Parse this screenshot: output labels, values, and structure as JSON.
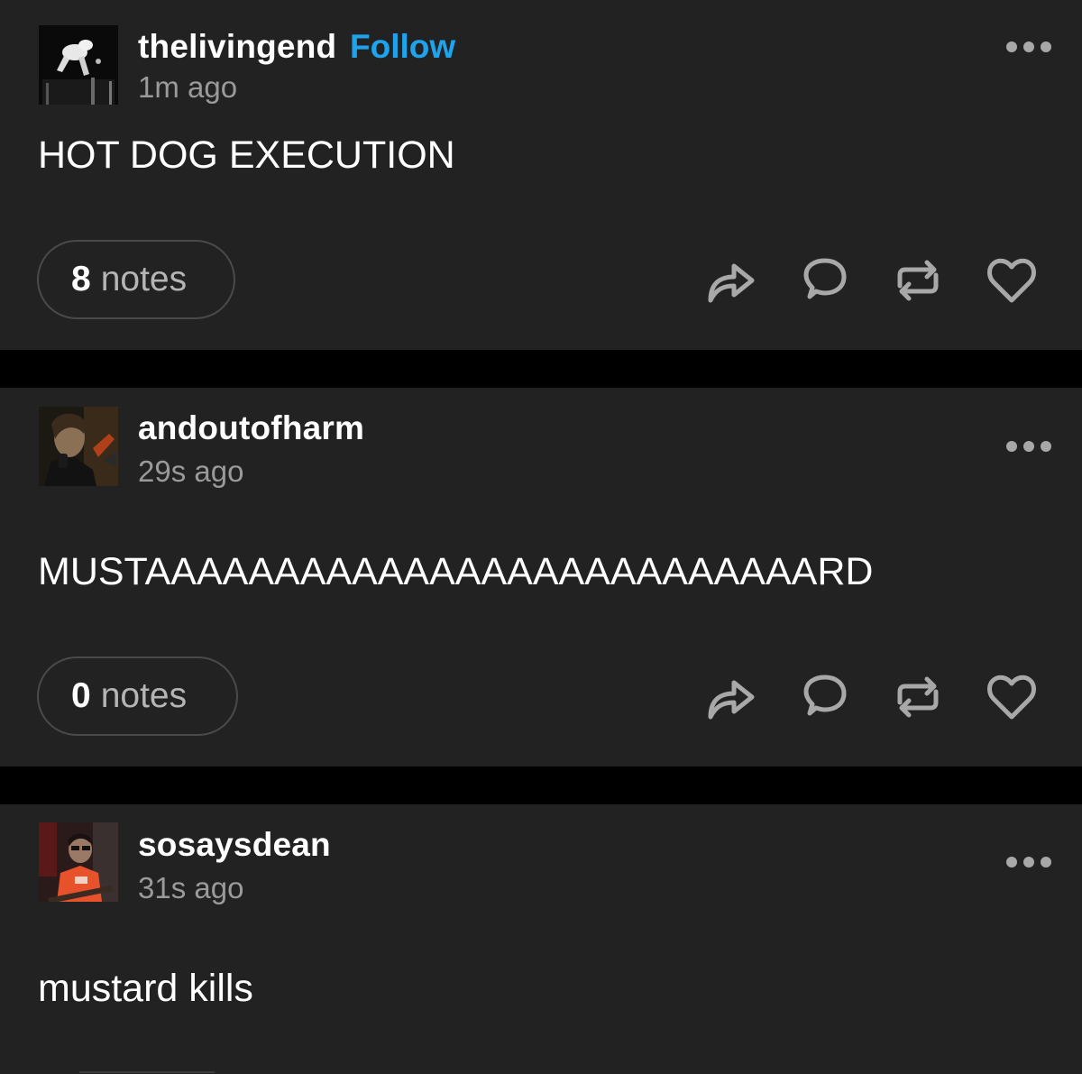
{
  "posts": [
    {
      "username": "thelivingend",
      "follow_label": "Follow",
      "timestamp": "1m ago",
      "body": "HOT DOG EXECUTION",
      "notes_count": "8",
      "notes_label": "notes"
    },
    {
      "username": "andoutofharm",
      "timestamp": "29s ago",
      "body": "MUSTAAAAAAAAAAAAAAAAAAAAAAAAAARD",
      "notes_count": "0",
      "notes_label": "notes"
    },
    {
      "username": "sosaysdean",
      "timestamp": "31s ago",
      "body": "mustard kills"
    }
  ],
  "icons": {
    "share": "share-arrow-icon",
    "reply": "reply-bubble-icon",
    "reblog": "reblog-icon",
    "like": "heart-icon",
    "more": "more-options-icon"
  },
  "colors": {
    "post_background": "#222222",
    "page_background": "#000000",
    "follow_accent": "#1fa3ec",
    "icon_gray": "#a8a8a8"
  }
}
